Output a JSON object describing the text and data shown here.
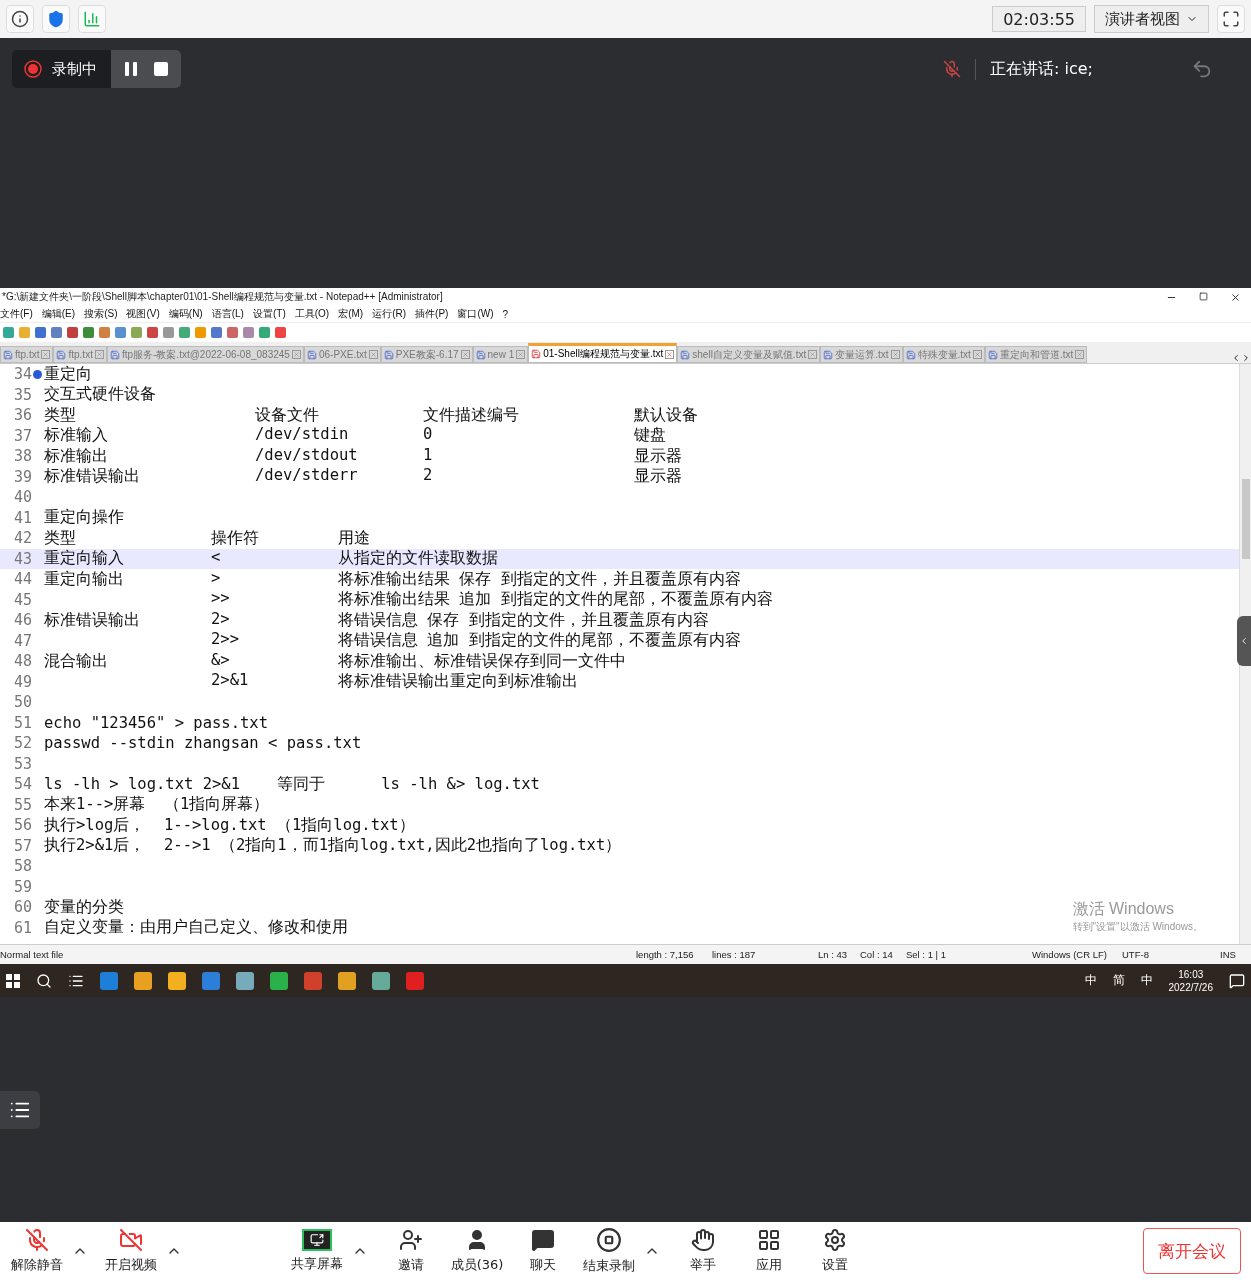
{
  "top_bar": {
    "timer": "02:03:55",
    "view_menu": "演讲者视图"
  },
  "recording": {
    "label": "录制中"
  },
  "speaker": "正在讲话: ice;",
  "notepad": {
    "title": "*G:\\新建文件夹\\一阶段\\Shell脚本\\chapter01\\01-Shell编程规范与变量.txt - Notepad++ [Administrator]",
    "menu": [
      "文件(F)",
      "编辑(E)",
      "搜索(S)",
      "视图(V)",
      "编码(N)",
      "语言(L)",
      "设置(T)",
      "工具(O)",
      "宏(M)",
      "运行(R)",
      "插件(P)",
      "窗口(W)",
      "?"
    ],
    "tabs": [
      {
        "label": "ftp.txt",
        "selected": false
      },
      {
        "label": "ftp.txt",
        "selected": false
      },
      {
        "label": "ftp服务-教案.txt@2022-06-08_083245",
        "selected": false
      },
      {
        "label": "06-PXE.txt",
        "selected": false
      },
      {
        "label": "PXE教案-6.17",
        "selected": false
      },
      {
        "label": "new 1",
        "selected": false
      },
      {
        "label": "01-Shell编程规范与变量.txt",
        "selected": true
      },
      {
        "label": "shell自定义变量及赋值.txt",
        "selected": false
      },
      {
        "label": "变量运算.txt",
        "selected": false
      },
      {
        "label": "特殊变量.txt",
        "selected": false
      },
      {
        "label": "重定向和管道.txt",
        "selected": false
      }
    ],
    "lines": [
      {
        "n": "34",
        "kind": "text",
        "cells": [
          "重定向"
        ],
        "bookmark": true,
        "current": false
      },
      {
        "n": "35",
        "kind": "text",
        "cells": [
          "交互式硬件设备"
        ],
        "bookmark": false,
        "current": false
      },
      {
        "n": "36",
        "kind": "four",
        "cells": [
          "类型",
          "设备文件",
          "文件描述编号",
          "默认设备"
        ],
        "bookmark": false,
        "current": false
      },
      {
        "n": "37",
        "kind": "four",
        "cells": [
          "标准输入",
          "/dev/stdin",
          "0",
          "键盘"
        ],
        "bookmark": false,
        "current": false
      },
      {
        "n": "38",
        "kind": "four",
        "cells": [
          "标准输出",
          "/dev/stdout",
          "1",
          "显示器"
        ],
        "bookmark": false,
        "current": false
      },
      {
        "n": "39",
        "kind": "four",
        "cells": [
          "标准错误输出",
          "/dev/stderr",
          "2",
          "显示器"
        ],
        "bookmark": false,
        "current": false
      },
      {
        "n": "40",
        "kind": "text",
        "bookmark": false,
        "current": false
      },
      {
        "n": "41",
        "kind": "text",
        "cells": [
          "重定向操作"
        ],
        "bookmark": false,
        "current": false
      },
      {
        "n": "42",
        "kind": "three",
        "cells": [
          "类型",
          "操作符",
          "用途"
        ],
        "bookmark": false,
        "current": false
      },
      {
        "n": "43",
        "kind": "three",
        "cells": [
          "重定向输入",
          "<",
          "从指定的文件读取数据"
        ],
        "bookmark": false,
        "current": true
      },
      {
        "n": "44",
        "kind": "three",
        "cells": [
          "重定向输出",
          ">",
          "将标准输出结果 保存 到指定的文件，并且覆盖原有内容"
        ],
        "bookmark": false,
        "current": false
      },
      {
        "n": "45",
        "kind": "three",
        "cells": [
          "",
          ">>",
          "将标准输出结果 追加 到指定的文件的尾部，不覆盖原有内容"
        ],
        "bookmark": false,
        "current": false
      },
      {
        "n": "46",
        "kind": "three",
        "cells": [
          "标准错误输出",
          "2>",
          "将错误信息 保存 到指定的文件，并且覆盖原有内容"
        ],
        "bookmark": false,
        "current": false
      },
      {
        "n": "47",
        "kind": "three",
        "cells": [
          "",
          "2>>",
          "将错误信息 追加 到指定的文件的尾部，不覆盖原有内容"
        ],
        "bookmark": false,
        "current": false
      },
      {
        "n": "48",
        "kind": "three",
        "cells": [
          "混合输出",
          "&>",
          "将标准输出、标准错误保存到同一文件中"
        ],
        "bookmark": false,
        "current": false
      },
      {
        "n": "49",
        "kind": "three",
        "cells": [
          "",
          "2>&1",
          "将标准错误输出重定向到标准输出"
        ],
        "bookmark": false,
        "current": false
      },
      {
        "n": "50",
        "kind": "text",
        "bookmark": false,
        "current": false
      },
      {
        "n": "51",
        "kind": "text",
        "cells": [
          "echo \"123456\" > pass.txt"
        ],
        "bookmark": false,
        "current": false
      },
      {
        "n": "52",
        "kind": "text",
        "cells": [
          "passwd --stdin zhangsan < pass.txt"
        ],
        "bookmark": false,
        "current": false
      },
      {
        "n": "53",
        "kind": "text",
        "bookmark": false,
        "current": false
      },
      {
        "n": "54",
        "kind": "text",
        "cells": [
          "ls -lh > log.txt 2>&1    等同于      ls -lh &> log.txt"
        ],
        "bookmark": false,
        "current": false
      },
      {
        "n": "55",
        "kind": "text",
        "cells": [
          "本来1-->屏幕  （1指向屏幕）"
        ],
        "bookmark": false,
        "current": false
      },
      {
        "n": "56",
        "kind": "text",
        "cells": [
          "执行>log后，  1-->log.txt （1指向log.txt）"
        ],
        "bookmark": false,
        "current": false
      },
      {
        "n": "57",
        "kind": "text",
        "cells": [
          "执行2>&1后，  2-->1 （2指向1，而1指向log.txt,因此2也指向了log.txt）"
        ],
        "bookmark": false,
        "current": false
      },
      {
        "n": "58",
        "kind": "text",
        "bookmark": false,
        "current": false
      },
      {
        "n": "59",
        "kind": "text",
        "bookmark": false,
        "current": false
      },
      {
        "n": "60",
        "kind": "text",
        "cells": [
          "变量的分类"
        ],
        "bookmark": false,
        "current": false
      },
      {
        "n": "61",
        "kind": "text",
        "cells": [
          "自定义变量：由用户自己定义、修改和使用"
        ],
        "bookmark": false,
        "current": false
      }
    ],
    "status": {
      "file_type": "Normal text file",
      "length": "length : 7,156",
      "lines": "lines : 187",
      "ln": "Ln : 43",
      "col": "Col : 14",
      "sel": "Sel : 1 | 1",
      "eol": "Windows (CR LF)",
      "encoding": "UTF-8",
      "mode": "INS"
    }
  },
  "activation": {
    "title": "激活 Windows",
    "hint": "转到\"设置\"以激活 Windows。"
  },
  "taskbar": {
    "tray": [
      "中",
      "简",
      "中"
    ],
    "time": "16:03",
    "date": "2022/7/26"
  },
  "toolbar": [
    {
      "kind": "mic-off",
      "label": "解除静音",
      "caret": true
    },
    {
      "kind": "video-off",
      "label": "开启视频",
      "caret": true
    },
    {
      "kind": "share",
      "label": "共享屏幕",
      "caret": true
    },
    {
      "kind": "invite",
      "label": "邀请",
      "caret": false
    },
    {
      "kind": "members",
      "label": "成员(36)",
      "caret": false
    },
    {
      "kind": "chat",
      "label": "聊天",
      "caret": false
    },
    {
      "kind": "stop-record",
      "label": "结束录制",
      "caret": true
    },
    {
      "kind": "hand",
      "label": "举手",
      "caret": false
    },
    {
      "kind": "apps",
      "label": "应用",
      "caret": false
    },
    {
      "kind": "settings",
      "label": "设置",
      "caret": false
    }
  ],
  "leave_button": "离开会议"
}
